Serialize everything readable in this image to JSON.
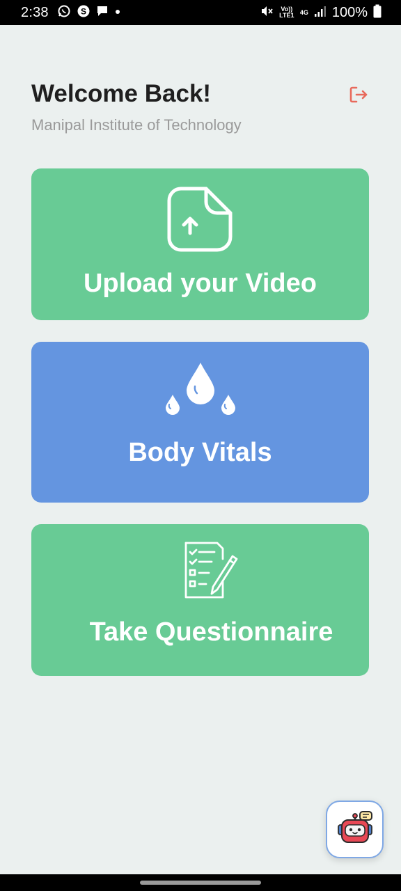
{
  "status_bar": {
    "time": "2:38",
    "network_volte": "Vo)) LTE1",
    "network_type": "4G",
    "battery": "100%",
    "icons": [
      "whatsapp-icon",
      "skype-icon",
      "message-icon",
      "dot-icon",
      "mute-icon",
      "signal-icon",
      "battery-icon"
    ]
  },
  "header": {
    "title": "Welcome Back!",
    "subtitle": "Manipal Institute of Technology",
    "logout_icon": "logout-icon",
    "logout_color": "#E86A5C"
  },
  "cards": [
    {
      "label": "Upload your Video",
      "icon": "file-upload-icon",
      "color": "#68CB95"
    },
    {
      "label": "Body Vitals",
      "icon": "water-drops-icon",
      "color": "#6495E0"
    },
    {
      "label": "Take Questionnaire",
      "icon": "checklist-icon",
      "color": "#68CB95"
    }
  ],
  "fab": {
    "icon": "chatbot-icon"
  }
}
